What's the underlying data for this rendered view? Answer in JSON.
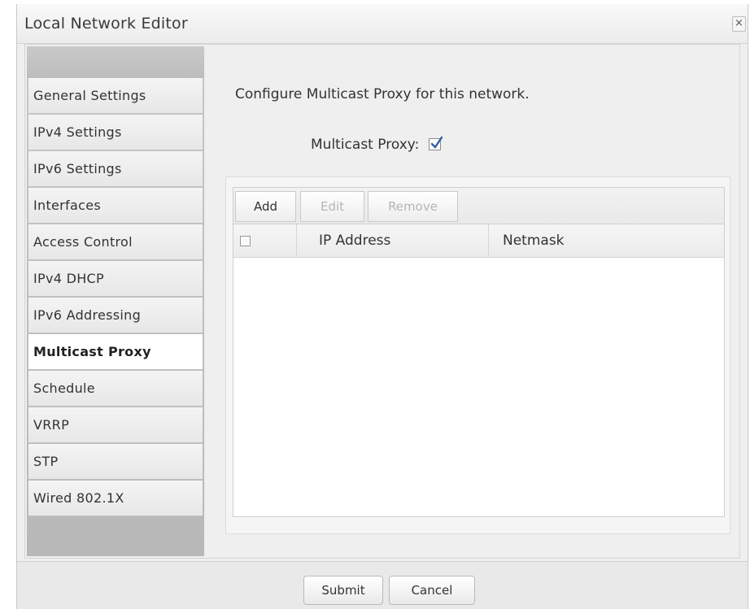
{
  "window": {
    "title": "Local Network Editor",
    "close_glyph": "×"
  },
  "sidebar": {
    "items": [
      {
        "label": "General Settings",
        "active": false
      },
      {
        "label": "IPv4 Settings",
        "active": false
      },
      {
        "label": "IPv6 Settings",
        "active": false
      },
      {
        "label": "Interfaces",
        "active": false
      },
      {
        "label": "Access Control",
        "active": false
      },
      {
        "label": "IPv4 DHCP",
        "active": false
      },
      {
        "label": "IPv6 Addressing",
        "active": false
      },
      {
        "label": "Multicast Proxy",
        "active": true
      },
      {
        "label": "Schedule",
        "active": false
      },
      {
        "label": "VRRP",
        "active": false
      },
      {
        "label": "STP",
        "active": false
      },
      {
        "label": "Wired 802.1X",
        "active": false
      }
    ]
  },
  "main": {
    "description": "Configure Multicast Proxy for this network.",
    "multicast_proxy_label": "Multicast Proxy:",
    "multicast_proxy_checked": true,
    "toolbar": {
      "add_label": "Add",
      "edit_label": "Edit",
      "remove_label": "Remove"
    },
    "table": {
      "columns": [
        "IP Address",
        "Netmask"
      ],
      "select_all_checked": false,
      "rows": []
    }
  },
  "footer": {
    "submit_label": "Submit",
    "cancel_label": "Cancel"
  }
}
